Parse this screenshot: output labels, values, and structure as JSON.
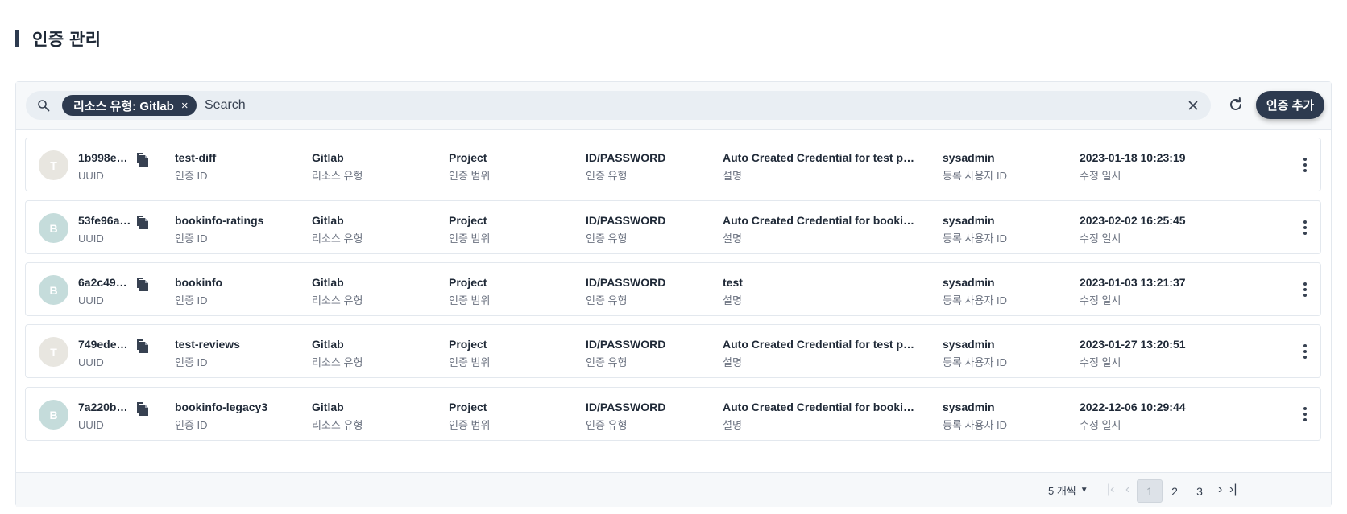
{
  "page": {
    "title": "인증 관리"
  },
  "search": {
    "filter_chip": "리소스 유형: Gitlab",
    "filter_chip_close": "×",
    "placeholder": "Search",
    "clear": "×"
  },
  "toolbar": {
    "add_label": "인증 추가"
  },
  "labels": {
    "uuid": "UUID",
    "auth_id": "인증 ID",
    "resource_type": "리소스 유형",
    "scope": "인증 범위",
    "auth_type": "인증 유형",
    "description": "설명",
    "registrant": "등록 사용자 ID",
    "modified": "수정 일시"
  },
  "rows": [
    {
      "avatar": "T",
      "avatar_color": "#e8e6e0",
      "uuid": "1b998e8…",
      "auth_id": "test-diff",
      "resource_type": "Gitlab",
      "scope": "Project",
      "auth_type": "ID/PASSWORD",
      "description": "Auto Created Credential for test proj…",
      "registrant": "sysadmin",
      "modified": "2023-01-18 10:23:19"
    },
    {
      "avatar": "B",
      "avatar_color": "#c5dcdb",
      "uuid": "53fe96ab…",
      "auth_id": "bookinfo-ratings",
      "resource_type": "Gitlab",
      "scope": "Project",
      "auth_type": "ID/PASSWORD",
      "description": "Auto Created Credential for bookinfo…",
      "registrant": "sysadmin",
      "modified": "2023-02-02 16:25:45"
    },
    {
      "avatar": "B",
      "avatar_color": "#c5dcdb",
      "uuid": "6a2c496…",
      "auth_id": "bookinfo",
      "resource_type": "Gitlab",
      "scope": "Project",
      "auth_type": "ID/PASSWORD",
      "description": "test",
      "registrant": "sysadmin",
      "modified": "2023-01-03 13:21:37"
    },
    {
      "avatar": "T",
      "avatar_color": "#e8e6e0",
      "uuid": "749ede1…",
      "auth_id": "test-reviews",
      "resource_type": "Gitlab",
      "scope": "Project",
      "auth_type": "ID/PASSWORD",
      "description": "Auto Created Credential for test proj…",
      "registrant": "sysadmin",
      "modified": "2023-01-27 13:20:51"
    },
    {
      "avatar": "B",
      "avatar_color": "#c5dcdb",
      "uuid": "7a220b4…",
      "auth_id": "bookinfo-legacy3",
      "resource_type": "Gitlab",
      "scope": "Project",
      "auth_type": "ID/PASSWORD",
      "description": "Auto Created Credential for bookinfo…",
      "registrant": "sysadmin",
      "modified": "2022-12-06 10:29:44"
    }
  ],
  "pagination": {
    "page_size": "5 개씩",
    "pages": [
      "1",
      "2",
      "3"
    ],
    "current_page": "1",
    "first": "|‹",
    "prev": "‹",
    "next": "›",
    "last": "›|"
  },
  "colors": {
    "accent": "#2d3a4f",
    "panel_bg": "#f6f8fa",
    "border": "#e3e8ee"
  }
}
